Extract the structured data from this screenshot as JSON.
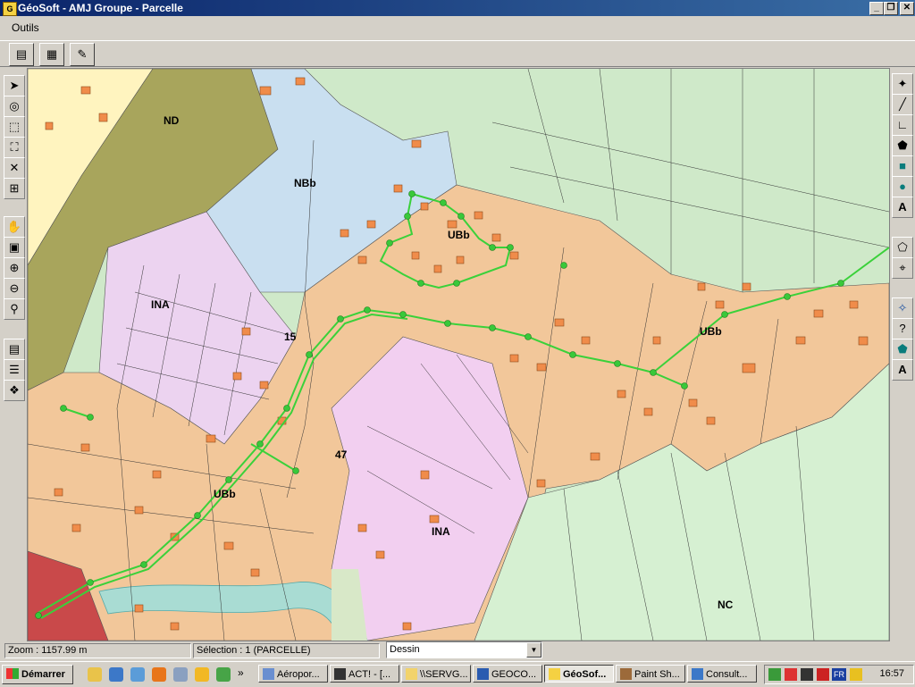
{
  "window": {
    "title": "GéoSoft - AMJ Groupe - Parcelle",
    "app_icon": "geosoft-icon",
    "controls": [
      "_",
      "❐",
      "✕"
    ]
  },
  "menu": {
    "items": [
      "Outils"
    ]
  },
  "map": {
    "zones": [
      "ND",
      "NBb",
      "UBb",
      "INA",
      "15",
      "UBb",
      "47",
      "UBb",
      "INA",
      "NC"
    ]
  },
  "status": {
    "zoom": "Zoom : 1157.99 m",
    "selection": "Sélection : 1 (PARCELLE)",
    "layer": "Dessin"
  },
  "taskbar": {
    "start": "Démarrer",
    "more": "»",
    "tasks": [
      "Aéropor...",
      "ACT! - [...",
      "\\\\SERVG...",
      "GEOCO...",
      "GéoSof...",
      "Paint Sh...",
      "Consult..."
    ],
    "clock": "16:57",
    "tray_lang": "FR"
  }
}
